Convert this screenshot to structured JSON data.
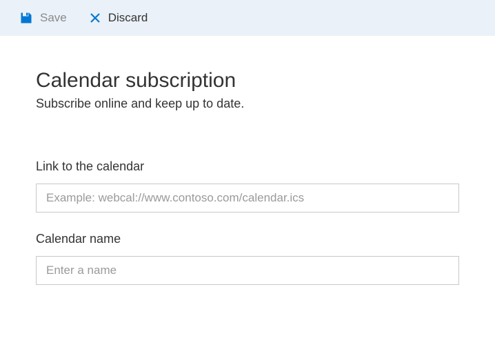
{
  "toolbar": {
    "save_label": "Save",
    "discard_label": "Discard"
  },
  "header": {
    "title": "Calendar subscription",
    "subtitle": "Subscribe online and keep up to date."
  },
  "form": {
    "link": {
      "label": "Link to the calendar",
      "placeholder": "Example: webcal://www.contoso.com/calendar.ics",
      "value": ""
    },
    "name": {
      "label": "Calendar name",
      "placeholder": "Enter a name",
      "value": ""
    }
  }
}
